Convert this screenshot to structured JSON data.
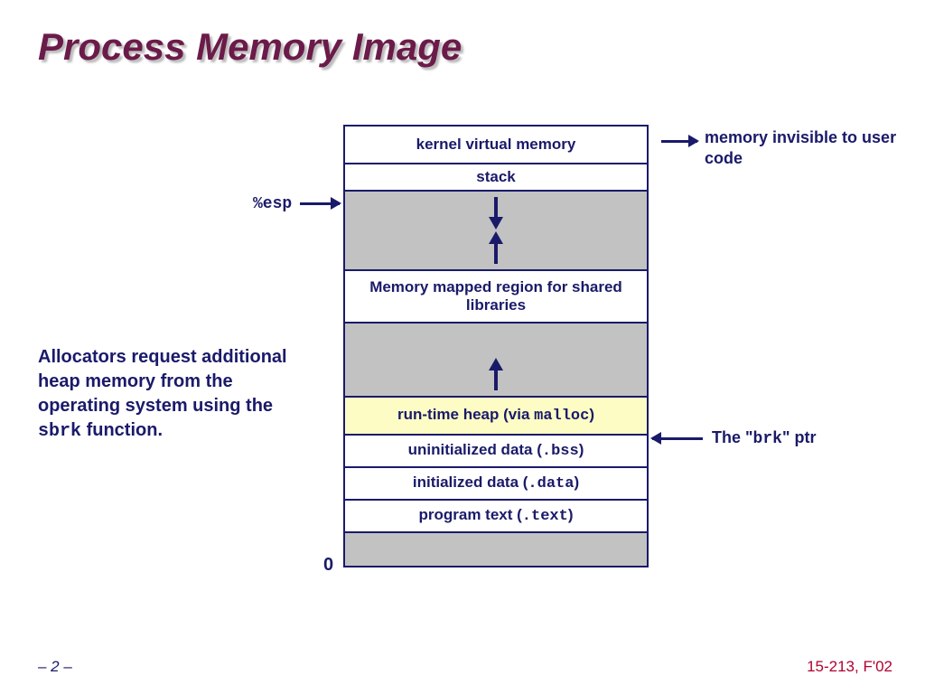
{
  "title": "Process Memory Image",
  "segments": {
    "kernel": "kernel virtual memory",
    "stack": "stack",
    "mmap": "Memory mapped region for shared libraries",
    "heap_prefix": "run-time heap (via ",
    "heap_mono": "malloc",
    "heap_suffix": ")",
    "bss_prefix": "uninitialized data (",
    "bss_mono": ".bss",
    "bss_suffix": ")",
    "data_prefix": "initialized data (",
    "data_mono": ".data",
    "data_suffix": ")",
    "text_prefix": "program text (",
    "text_mono": ".text",
    "text_suffix": ")"
  },
  "labels": {
    "esp": "%esp",
    "zero": "0"
  },
  "annotations": {
    "kernel": "memory invisible to user code",
    "brk_prefix": "The \"",
    "brk_mono": "brk",
    "brk_suffix": "\" ptr",
    "alloc_prefix": "Allocators request additional heap memory from the operating system using the ",
    "alloc_mono": "sbrk",
    "alloc_suffix": " function."
  },
  "footer": {
    "left": "– 2 –",
    "right": "15-213, F'02"
  }
}
